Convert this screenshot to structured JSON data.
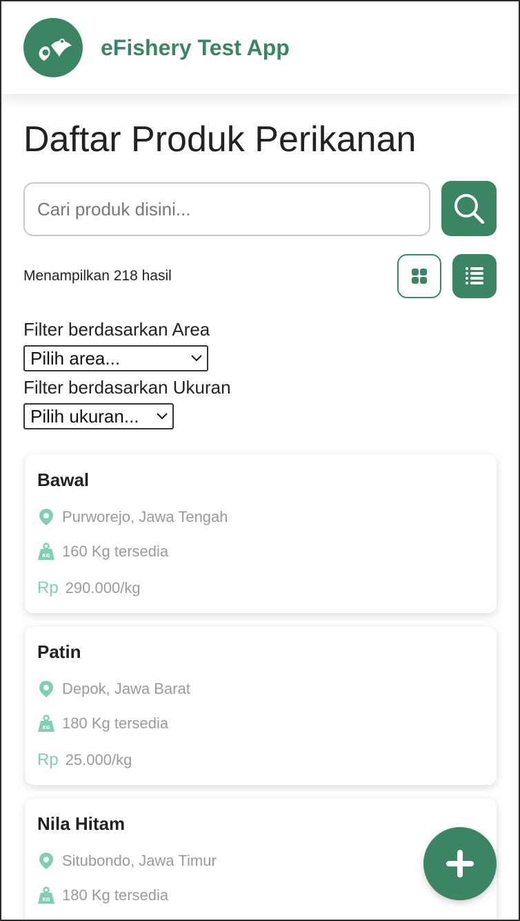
{
  "header": {
    "app_title": "eFishery Test App",
    "logo_icon": "fish-logo-icon"
  },
  "page": {
    "title": "Daftar Produk Perikanan"
  },
  "search": {
    "placeholder": "Cari produk disini...",
    "value": "",
    "button_icon": "search-icon"
  },
  "results": {
    "count_text": "Menampilkan 218 hasil"
  },
  "view_toggle": {
    "grid_icon": "grid-view-icon",
    "list_icon": "list-view-icon",
    "active": "list"
  },
  "filters": {
    "area_label": "Filter berdasarkan Area",
    "area_selected": "Pilih area...",
    "size_label": "Filter berdasarkan Ukuran",
    "size_selected": "Pilih ukuran..."
  },
  "products": [
    {
      "name": "Bawal",
      "location": "Purworejo, Jawa Tengah",
      "stock": "160 Kg tersedia",
      "currency": "Rp",
      "price": "290.000/kg"
    },
    {
      "name": "Patin",
      "location": "Depok, Jawa Barat",
      "stock": "180 Kg tersedia",
      "currency": "Rp",
      "price": "25.000/kg"
    },
    {
      "name": "Nila Hitam",
      "location": "Situbondo, Jawa Timur",
      "stock": "180 Kg tersedia",
      "currency": "Rp",
      "price": ""
    }
  ],
  "fab": {
    "icon": "plus-icon"
  },
  "colors": {
    "brand": "#3b8565",
    "accent_light": "#7fcfb0",
    "muted_text": "#9a9a9a"
  }
}
